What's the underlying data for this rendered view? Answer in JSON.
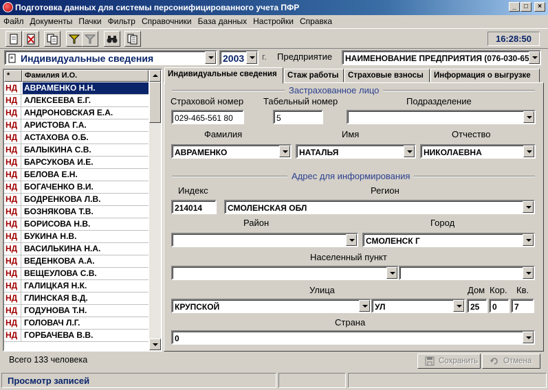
{
  "window": {
    "title": "Подготовка данных для системы персонифицированного учета ПФР",
    "minimize": "_",
    "maximize": "□",
    "close": "×"
  },
  "menu": [
    "Файл",
    "Документы",
    "Пачки",
    "Фильтр",
    "Справочники",
    "База данных",
    "Настройки",
    "Справка"
  ],
  "toolbar": {
    "clock": "16:28:50",
    "buttons": [
      "new-document-icon",
      "delete-document-icon",
      "copy-document-icon",
      "filter-icon",
      "filter-off-icon",
      "binoculars-icon",
      "pages-icon"
    ]
  },
  "selector": {
    "doc_type": "Индивидуальные сведения",
    "year": "2003",
    "year_suffix": "г.",
    "enterprise_label": "Предприятие",
    "enterprise_value": "НАИМЕНОВАНИЕ ПРЕДПРИЯТИЯ (076-030-654"
  },
  "list": {
    "col_star": "*",
    "col_name": "Фамилия И.О.",
    "rows": [
      {
        "type": "НД",
        "name": "АВРАМЕНКО Н.Н."
      },
      {
        "type": "НД",
        "name": "АЛЕКСЕЕВА Е.Г."
      },
      {
        "type": "НД",
        "name": "АНДРОНОВСКАЯ Е.А."
      },
      {
        "type": "НД",
        "name": "АРИСТОВА Г.А."
      },
      {
        "type": "НД",
        "name": "АСТАХОВА О.Б."
      },
      {
        "type": "НД",
        "name": "БАЛЫКИНА С.В."
      },
      {
        "type": "НД",
        "name": "БАРСУКОВА И.Е."
      },
      {
        "type": "НД",
        "name": "БЕЛОВА Е.Н."
      },
      {
        "type": "НД",
        "name": "БОГАЧЕНКО В.И."
      },
      {
        "type": "НД",
        "name": "БОДРЕНКОВА Л.В."
      },
      {
        "type": "НД",
        "name": "БОЗНЯКОВА Т.В."
      },
      {
        "type": "НД",
        "name": "БОРИСОВА Н.В."
      },
      {
        "type": "НД",
        "name": "БУКИНА Н.В."
      },
      {
        "type": "НД",
        "name": "ВАСИЛЬКИНА Н.А."
      },
      {
        "type": "НД",
        "name": "ВЕДЕНКОВА А.А."
      },
      {
        "type": "НД",
        "name": "ВЕЩЕУЛОВА С.В."
      },
      {
        "type": "НД",
        "name": "ГАЛИЦКАЯ Н.К."
      },
      {
        "type": "НД",
        "name": "ГЛИНСКАЯ В.Д."
      },
      {
        "type": "НД",
        "name": "ГОДУНОВА Т.Н."
      },
      {
        "type": "НД",
        "name": "ГОЛОВАЧ Л.Г."
      },
      {
        "type": "НД",
        "name": "ГОРБАЧЕВА В.В."
      }
    ],
    "total": "Всего 133 человека"
  },
  "tabs": [
    "Индивидуальные сведения",
    "Стаж работы",
    "Страховые взносы",
    "Информация о выгрузке"
  ],
  "insured": {
    "section": "Застрахованное лицо",
    "snils_label": "Страховой номер",
    "snils": "029-465-561 80",
    "tab_label": "Табельный номер",
    "tab_number": "5",
    "dept_label": "Подразделение",
    "dept": "",
    "surname_label": "Фамилия",
    "surname": "АВРАМЕНКО",
    "name_label": "Имя",
    "name": "НАТАЛЬЯ",
    "patronymic_label": "Отчество",
    "patronymic": "НИКОЛАЕВНА"
  },
  "address": {
    "section": "Адрес для информирования",
    "index_label": "Индекс",
    "index": "214014",
    "region_label": "Регион",
    "region": "СМОЛЕНСКАЯ ОБЛ",
    "district_label": "Район",
    "district": "",
    "city_label": "Город",
    "city": "СМОЛЕНСК Г",
    "locality_label": "Населенный пункт",
    "locality": "",
    "locality_type": "",
    "street_label": "Улица",
    "street": "КРУПСКОЙ",
    "street_type": "УЛ",
    "house_label": "Дом",
    "house": "25",
    "korp_label": "Кор.",
    "korp": "0",
    "kv_label": "Кв.",
    "kv": "7",
    "country_label": "Страна",
    "country": "0"
  },
  "actions": {
    "save": "Сохранить",
    "cancel": "Отмена"
  },
  "status": {
    "mode": "Просмотр записей"
  }
}
